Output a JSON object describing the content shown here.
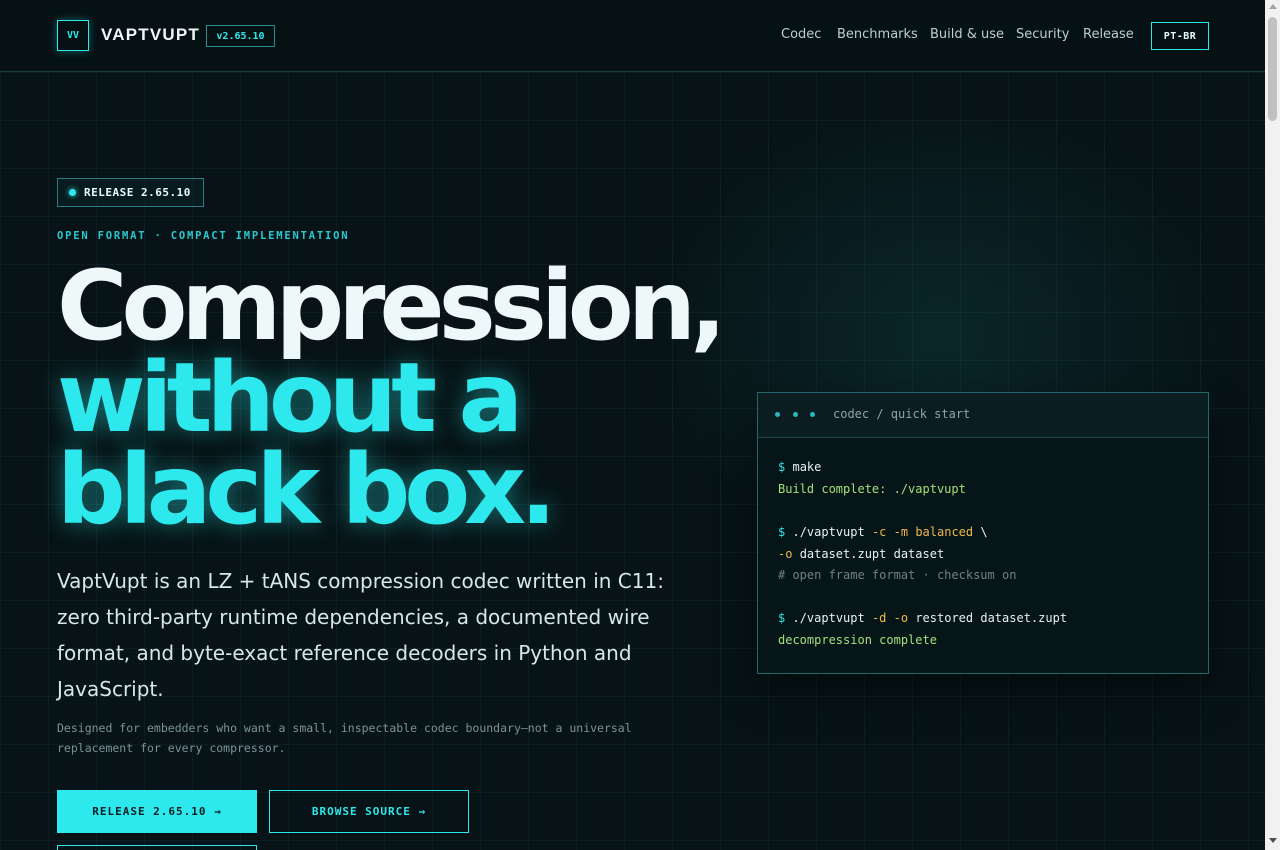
{
  "header": {
    "logo": "VV",
    "brand": "VAPTVUPT",
    "version": "v2.65.10",
    "nav": [
      {
        "label": "Codec"
      },
      {
        "label": "Benchmarks"
      },
      {
        "label": "Build & use"
      },
      {
        "label": "Security"
      },
      {
        "label": "Release"
      }
    ],
    "language": "PT-BR"
  },
  "hero": {
    "release_chip": "RELEASE 2.65.10",
    "eyebrow": "OPEN FORMAT · COMPACT IMPLEMENTATION",
    "headline": [
      "Compression,",
      "without a",
      "black box."
    ],
    "lead": "VaptVupt is an LZ + tANS compression codec written in C11: zero third-party runtime dependencies, a documented wire format, and byte-exact reference decoders in Python and JavaScript.",
    "note": "Designed for embedders who want a small, inspectable codec boundary—not a universal replacement for every compressor.",
    "primary_button": "RELEASE 2.65.10 →",
    "secondary_button": "BROWSE SOURCE →"
  },
  "terminal": {
    "title": "codec / quick start",
    "lines": {
      "l1_prompt": "$",
      "l1_cmd": "make",
      "l2": "Build complete: ./vaptvupt",
      "l3_prompt": "$",
      "l3_cmd": "./vaptvupt",
      "l3_flag1": "-c",
      "l3_flag2": "-m",
      "l3_arg": "balanced",
      "l3_tail": "\\",
      "l4_flag": "-o",
      "l4_rest": "dataset.zupt dataset",
      "l5": "# open frame format · checksum on",
      "l6_prompt": "$",
      "l6_cmd": "./vaptvupt",
      "l6_flag1": "-d",
      "l6_flag2": "-o",
      "l6_rest": "restored dataset.zupt",
      "l7": "decompression complete"
    }
  },
  "colors": {
    "accent": "#2de8ec",
    "background": "#071316",
    "success": "#a4e07a",
    "flag": "#f0b94c"
  }
}
